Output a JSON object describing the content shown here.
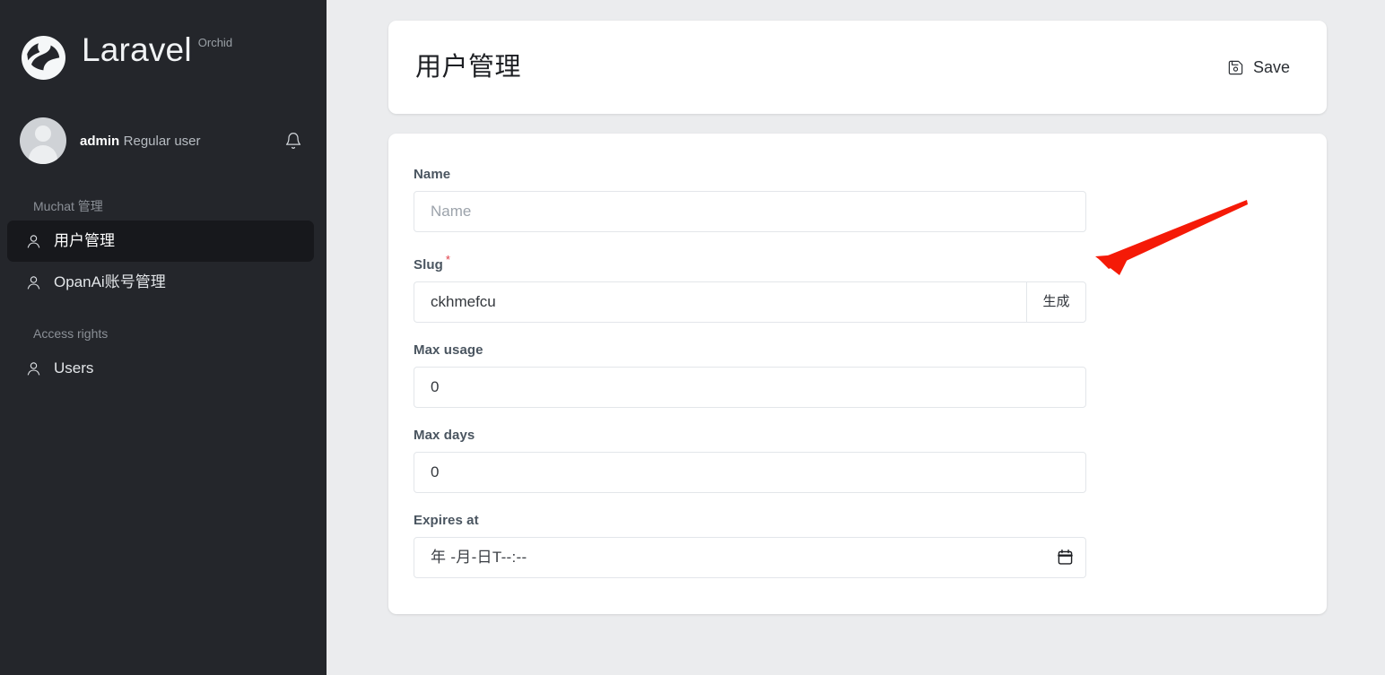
{
  "sidebar": {
    "brand": {
      "logo_icon": "laravel-orchid-logo",
      "name": "Laravel",
      "suffix": "Orchid"
    },
    "profile": {
      "avatar_icon": "user-avatar",
      "name": "admin",
      "role": "Regular user",
      "bell_icon": "bell-icon"
    },
    "groups": [
      {
        "heading": "Muchat 管理",
        "items": [
          {
            "label": "用户管理",
            "icon": "user-icon",
            "active": true
          },
          {
            "label": "OpanAi账号管理",
            "icon": "user-icon",
            "active": false
          }
        ]
      },
      {
        "heading": "Access rights",
        "items": [
          {
            "label": "Users",
            "icon": "user-icon",
            "active": false
          }
        ]
      }
    ]
  },
  "header": {
    "title": "用户管理",
    "save_label": "Save",
    "save_icon": "save-floppy-icon"
  },
  "form": {
    "fields": {
      "name": {
        "label": "Name",
        "placeholder": "Name",
        "value": ""
      },
      "slug": {
        "label": "Slug",
        "required_marker": "*",
        "value": "ckhmefcu",
        "placeholder": "",
        "generate_label": "生成"
      },
      "max_usage": {
        "label": "Max usage",
        "value": "0",
        "placeholder": ""
      },
      "max_days": {
        "label": "Max days",
        "value": "0",
        "placeholder": ""
      },
      "expires_at": {
        "label": "Expires at",
        "placeholder": "年 -月-日T--:--",
        "value": "",
        "calendar_icon": "calendar-icon"
      }
    }
  },
  "annotation": {
    "arrow_color": "#f51a07",
    "arrow_name": "red-pointer-arrow",
    "points_to": "生成"
  },
  "colors": {
    "sidebar_bg": "#24262b",
    "sidebar_active_bg": "#17181c",
    "page_bg": "#ebecee",
    "card_bg": "#ffffff",
    "label_text": "#4a5560",
    "required": "#e03b45",
    "arrow": "#f51a07"
  }
}
